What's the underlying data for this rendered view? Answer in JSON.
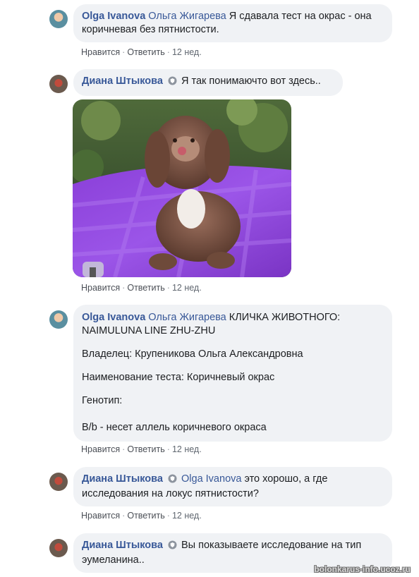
{
  "comments": [
    {
      "author": "Olga Ivanova",
      "mention": "Ольга Жигарева",
      "text": "Я сдавала тест на окрас - она коричневая без пятнистости."
    },
    {
      "author": "Диана Штыкова",
      "text": "Я так понимаючто вот здесь.."
    },
    {
      "author": "Olga Ivanova",
      "mention": "Ольга Жигарева",
      "text_line1": "КЛИЧКА ЖИВОТНОГО:",
      "text_line2": "NAIMULUNA LINE ZHU-ZHU",
      "owner": "Владелец: Крупеникова Ольга Александровна",
      "test": "Наименование теста: Коричневый окрас",
      "genotype": "Генотип:",
      "result": "B/b - несет аллель коричневого окраса"
    },
    {
      "author": "Диана Штыкова",
      "mention": "Olga Ivanova",
      "text": "это хорошо, а где исследования на локус пятнистости?"
    },
    {
      "author": "Диана Штыкова",
      "text": "Вы показываете исследование на тип эумеланина.."
    }
  ],
  "meta": {
    "like": "Нравится",
    "reply": "Ответить",
    "time": "12 нед."
  },
  "watermark": "bolonkarus-info.ucoz.ru",
  "colors": {
    "name": "#385898",
    "bubble": "#f0f2f5"
  }
}
